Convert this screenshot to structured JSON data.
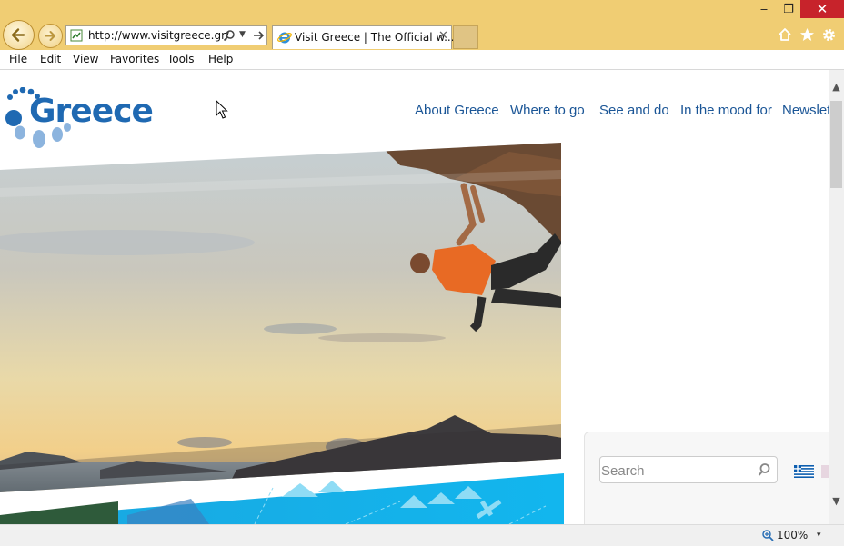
{
  "browser": {
    "window_controls": {
      "minimize": "‒",
      "restore": "❐",
      "close": "✕"
    },
    "address": {
      "url": "http://www.visitgreece.gr/"
    },
    "tab": {
      "title": "Visit Greece | The Official w...",
      "close": "✕"
    },
    "menu": [
      "File",
      "Edit",
      "View",
      "Favorites",
      "Tools",
      "Help"
    ],
    "zoom": "100%",
    "zoom_drop": "▾",
    "scroll": {
      "up": "▲",
      "down": "▼"
    }
  },
  "site": {
    "logo_text": "Greece",
    "nav": [
      "About Greece",
      "Where to go",
      "See and do",
      "In the mood for",
      "Newslett"
    ],
    "search": {
      "placeholder": "Search"
    }
  },
  "colors": {
    "chrome": "#f0cd73",
    "link": "#1a5596",
    "logo_blue": "#1f69b2",
    "close_red": "#c7232b"
  }
}
